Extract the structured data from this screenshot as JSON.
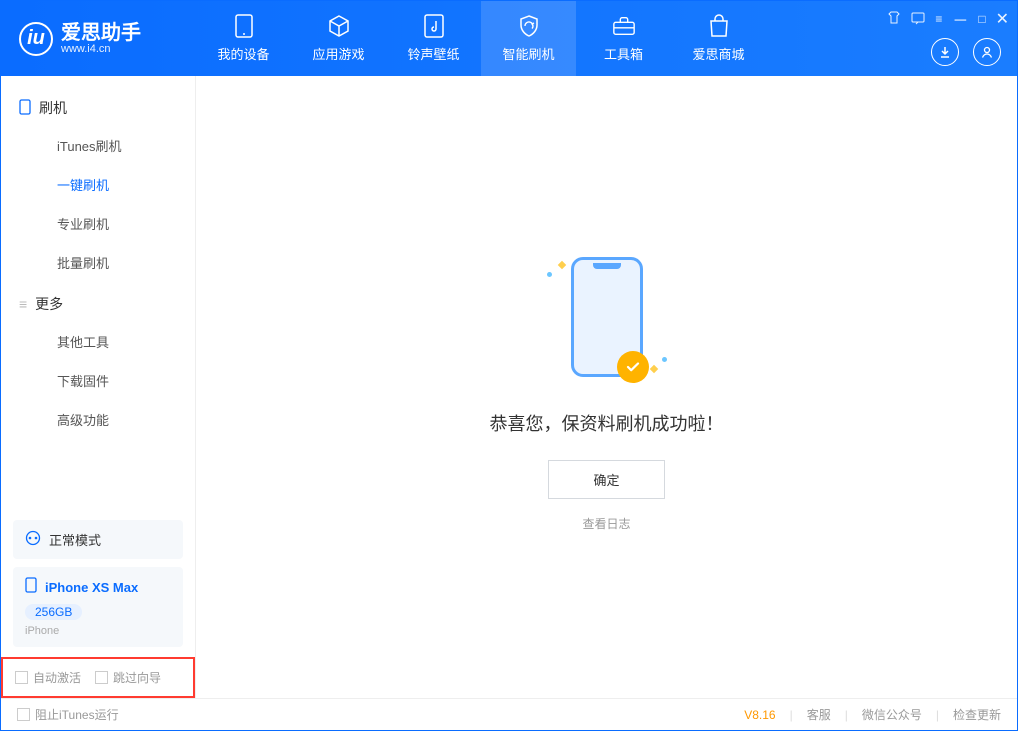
{
  "app": {
    "name": "爱思助手",
    "url": "www.i4.cn"
  },
  "tabs": {
    "device": "我的设备",
    "apps": "应用游戏",
    "ringtone": "铃声壁纸",
    "flash": "智能刷机",
    "toolbox": "工具箱",
    "store": "爱思商城"
  },
  "sidebar": {
    "group_flash": "刷机",
    "itunes_flash": "iTunes刷机",
    "one_key_flash": "一键刷机",
    "pro_flash": "专业刷机",
    "batch_flash": "批量刷机",
    "group_more": "更多",
    "other_tools": "其他工具",
    "download_firmware": "下载固件",
    "advanced": "高级功能"
  },
  "mode": {
    "label": "正常模式"
  },
  "device": {
    "name": "iPhone XS Max",
    "storage": "256GB",
    "type": "iPhone"
  },
  "options": {
    "auto_activate": "自动激活",
    "skip_guide": "跳过向导"
  },
  "main": {
    "success": "恭喜您，保资料刷机成功啦！",
    "ok": "确定",
    "view_log": "查看日志"
  },
  "footer": {
    "block_itunes": "阻止iTunes运行",
    "version": "V8.16",
    "support": "客服",
    "wechat": "微信公众号",
    "check_update": "检查更新"
  }
}
